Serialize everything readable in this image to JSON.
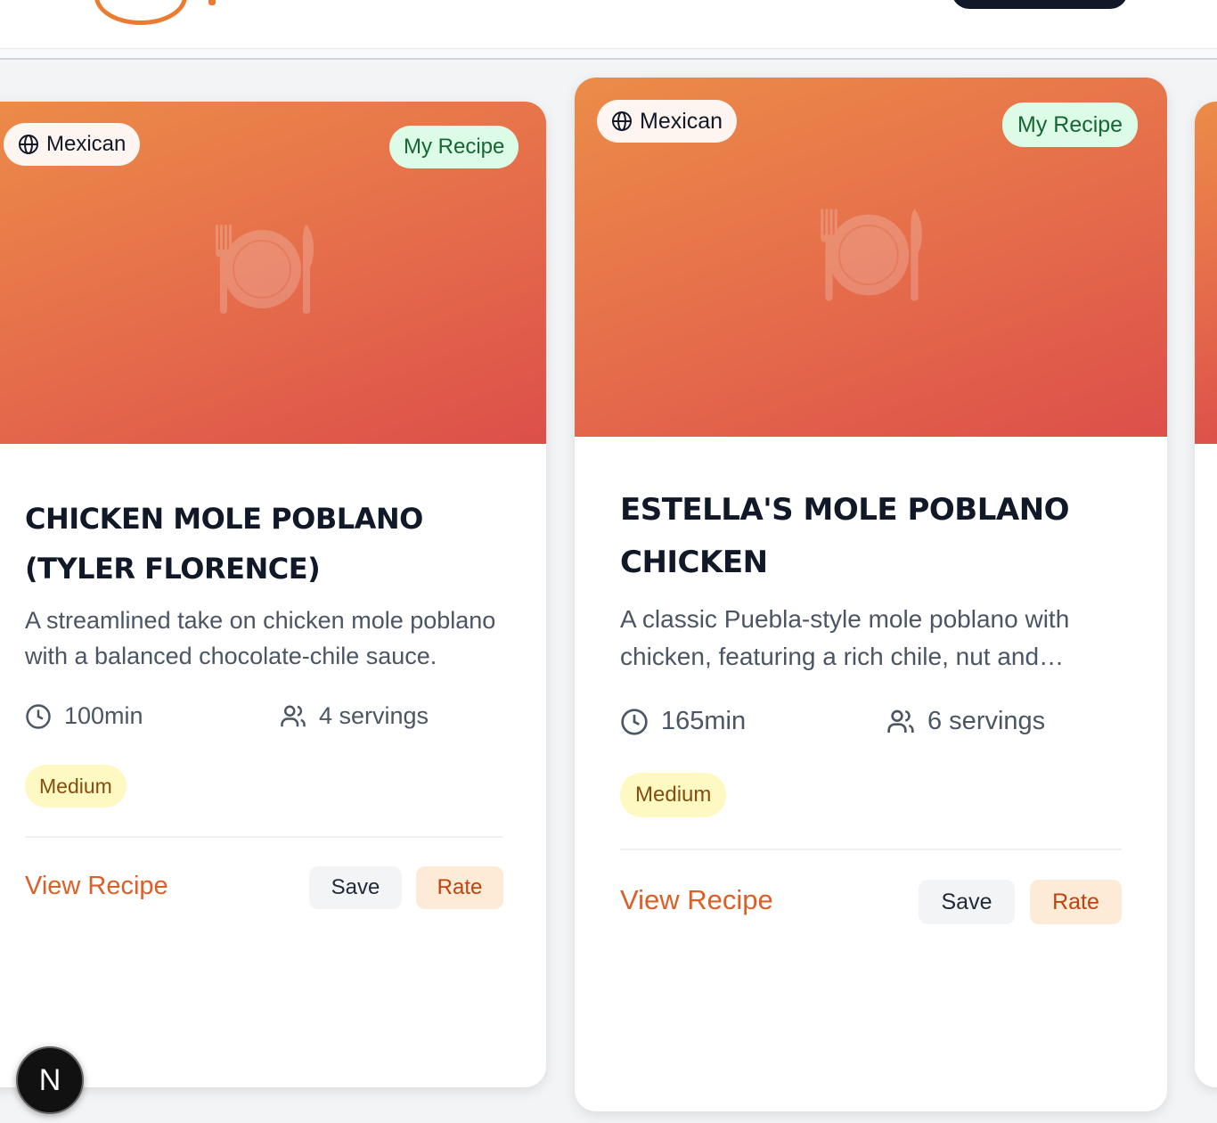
{
  "recipes": [
    {
      "cuisine": "Mexican",
      "owner_badge": "My Recipe",
      "title": "Chicken Mole Poblano (Tyler Florence)",
      "description": "A streamlined take on chicken mole poblano with a balanced chocolate-chile sauce.",
      "time": "100min",
      "servings": "4 servings",
      "difficulty": "Medium",
      "view_label": "View Recipe",
      "save_label": "Save",
      "rate_label": "Rate"
    },
    {
      "cuisine": "Mexican",
      "owner_badge": "My Recipe",
      "title": "Estella's Mole Poblano Chicken",
      "description": "A classic Puebla-style mole poblano with chicken, featuring a rich chile, nut and chocolate sauce.",
      "time": "165min",
      "servings": "6 servings",
      "difficulty": "Medium",
      "view_label": "View Recipe",
      "save_label": "Save",
      "rate_label": "Rate"
    }
  ],
  "dev_badge": {
    "letter": "N"
  },
  "icons": {
    "cuisine": "globe-icon",
    "placeholder": "plate-utensils-icon",
    "time": "clock-icon",
    "servings": "users-icon"
  },
  "colors": {
    "accent": "#dc5f26",
    "hero_start": "#ec8c48",
    "hero_end": "#dc4f4a",
    "mine_badge_bg": "#dcfce7",
    "mine_badge_text": "#166534",
    "difficulty_bg": "#fef9c3",
    "difficulty_text": "#854d0e"
  }
}
